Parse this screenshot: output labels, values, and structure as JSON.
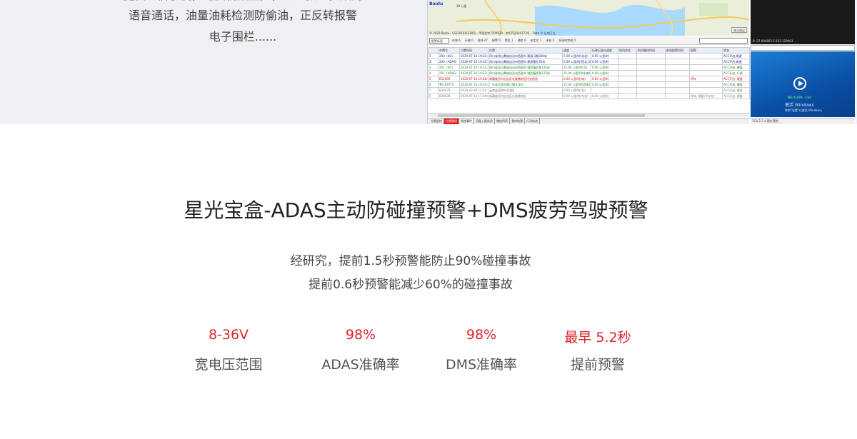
{
  "top_section": {
    "partial_line": "提供通信手机，电脑视频监控，通过预置，双向",
    "line1": "语音通话，油量油耗检测防偷油，正反转报警",
    "line2": "电子围栏......"
  },
  "screenshot": {
    "map": {
      "brand": "Baidu",
      "scale": "10 公里",
      "copyright": "© 2020 Baidu - GS(2019)5218号 - 甲测资字1100930 - 京ICP证030173号 - Data © 长地万方",
      "button": "路况图层"
    },
    "toolbar": {
      "select": "报警标签",
      "items": [
        "在线 6",
        "行驶 0",
        "离线 47",
        "报警 0",
        "警告 1",
        "通信 0",
        "未定位 1",
        "未启 0",
        "多选时完成 0"
      ]
    },
    "table": {
      "headers": [
        "",
        "车牌号",
        "位置时间",
        "位置",
        "速度",
        "行驶记录仪速度",
        "前机信息",
        "前机最终时间",
        "前机报警时间",
        "报警",
        "状态"
      ],
      "rows": [
        {
          "n": "1",
          "plate": "200（4G)",
          "time": "2020-07-14 19:32:46",
          "pos": "四川省凉山彝族自治州西昌市 建昌马路306米",
          "speed": "0.00 公里/时(北北)",
          "rec": "0.00 公里/时",
          "status": "ACC开启,熄速",
          "color": "#1a1a8a"
        },
        {
          "n": "2",
          "plate": "200（ADAS)",
          "time": "2020-07-14 19:32:53",
          "pos": "四川省凉山彝族自治州西昌市 建昌雷伦35米",
          "speed": "0.00 公里/时(西北,30度)",
          "rec": "0.00 公里/时",
          "status": "ACC开启,熄速",
          "color": "#1a1a8a"
        },
        {
          "n": "3",
          "plate": "201（4G)",
          "time": "2020-07-14 19:32:43",
          "pos": "四川省凉山彝族自治州西昌市 城西镇西角120米",
          "speed": "25.00 公里/时(北)",
          "rec": "0.00 公里/时",
          "status": "ACC开启, 硬盘",
          "color": "#1a8a1a"
        },
        {
          "n": "4",
          "plate": "201（ADAS)",
          "time": "2020-07-14 19:32:44",
          "pos": "四川省凉山彝族自治州西昌市 城西镇西角123米",
          "speed": "25.00 公里/时(东南)",
          "rec": "0.00 公里/时",
          "status": "ACC开启, 行驶",
          "color": "#1a8a1a"
        },
        {
          "n": "5",
          "plate": "B12006",
          "time": "2020-07-14 19:28:51",
          "pos": "新疆维吾尔自治区吐鲁番地区托克逊县",
          "speed": "0.00 公里/时(南)",
          "rec": "0.00 公里/时",
          "status": "ACC开启, 硬盘",
          "alarm": "停车",
          "color": "#d01010"
        },
        {
          "n": "6",
          "plate": "粤S.067TU",
          "time": "2020-07-14 19:32:41",
          "pos": "广东省东莞市黄江镇长龙村",
          "speed": "25.00 公里/时(西南)",
          "rec": "0.00 公里/时",
          "status": "ACC开启, 硬盘",
          "color": "#1a8a1a"
        },
        {
          "n": "7",
          "plate": "B20079",
          "time": "2020-03-30 11:51:30",
          "pos": "云南省昆明市官渡区",
          "speed": "0.00 公里/时(北)",
          "rec": "",
          "status": "ACC开启, 硬盘",
          "color": "#777"
        },
        {
          "n": "8",
          "plate": "B26028",
          "time": "2020-07-14 17:28:02",
          "pos": "新疆维吾尔自治区吐鲁番地区",
          "speed": "0.00 公里/时(东北)",
          "rec": "0.00 公里/时",
          "status": "ACC开启, 硬盘",
          "alarm": "停电, 硬盘(不存在)",
          "color": "#777"
        }
      ]
    },
    "tabs": [
      "位置监控",
      "位置管理",
      "系统事件",
      "设备上报信息",
      "播放列表",
      "我的地图",
      "行动轨迹"
    ],
    "camera": {
      "coord": "B: 27.904803 E:102.129903",
      "channel_label": "粤S.0189X - CH4",
      "watermark": "激活 Windows",
      "watermark_sub": "转到\"设置\"以激活 Windows。",
      "tabs": "1(3) 2 3 4 图片预览"
    }
  },
  "main": {
    "title": "星光宝盒-ADAS主动防碰撞预警+DMS疲劳驾驶预警",
    "desc_line1": "经研究，提前1.5秒预警能防止90%碰撞事故",
    "desc_line2": "提前0.6秒预警能减少60%的碰撞事故",
    "stats": [
      {
        "value": "8-36V",
        "label": "宽电压范围"
      },
      {
        "value": "98%",
        "label": "ADAS准确率"
      },
      {
        "value": "98%",
        "label": "DMS准确率"
      },
      {
        "value": "最早 5.2秒",
        "label": "提前预警"
      }
    ]
  },
  "colors": {
    "accent_red": "#d9262c",
    "top_band_bg": "#eef0f3",
    "text_dark": "#222222",
    "text_gray": "#555555"
  }
}
